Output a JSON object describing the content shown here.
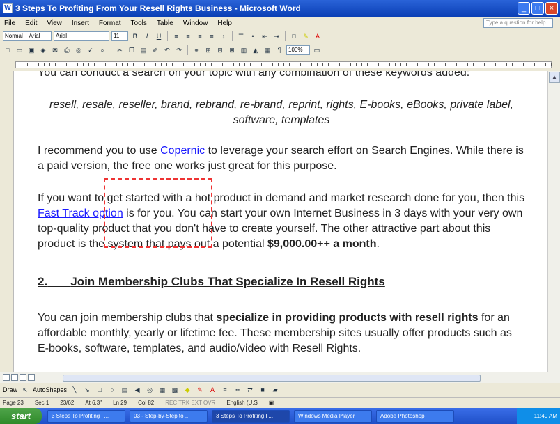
{
  "window": {
    "title": "3 Steps To Profiting From Your Resell Rights Business - Microsoft Word",
    "icon": "word-icon"
  },
  "menu": [
    "File",
    "Edit",
    "View",
    "Insert",
    "Format",
    "Tools",
    "Table",
    "Window",
    "Help"
  ],
  "ask_box": {
    "placeholder": "Type a question for help"
  },
  "toolbar": {
    "style_value": "Normal + Arial",
    "font_value": "Arial",
    "size_value": "11",
    "zoom_value": "100%"
  },
  "document": {
    "line_top": "You can conduct a search on your topic with any combination of these keywords added:",
    "keywords": "resell, resale, reseller, brand, rebrand, re-brand, reprint, rights, E-books, eBooks, private label, software, templates",
    "p1_pre": "I recommend you to use ",
    "p1_link": "Copernic",
    "p1_post": " to leverage your search effort on Search Engines. While there is a paid version, the free one works just great for this purpose.",
    "p2_pre": "If you want to get started with a hot product in demand and market research done for you, then this ",
    "p2_link": "Fast Track option",
    "p2_post": " is for you. You can start your own Internet Business in 3 days with your very own top-quality product that you don't have to create yourself. The other attractive part about this product is the system that pays out a potential ",
    "p2_bold": "$9,000.00++ a month",
    "p2_end": ".",
    "heading_num": "2.",
    "heading_text": "Join Membership Clubs That Specialize In Resell Rights",
    "p3_pre": "You can join membership clubs that ",
    "p3_bold": "specialize in providing products with resell rights",
    "p3_post": " for an affordable monthly, yearly or lifetime fee. These membership sites usually offer products such as E-books, software, templates, and audio/video with Resell Rights."
  },
  "drawbar": {
    "draw_label": "Draw",
    "autoshapes_label": "AutoShapes"
  },
  "status": {
    "page": "Page 23",
    "sec": "Sec 1",
    "pages": "23/62",
    "at": "At 6.3\"",
    "ln": "Ln 29",
    "col": "Col 82",
    "modes": "REC TRK EXT OVR",
    "lang": "English (U.S"
  },
  "taskbar": {
    "start_label": "start",
    "tasks": [
      "3 Steps To Profiting F...",
      "03 - Step-by-Step to ...",
      "3 Steps To Profiting F...",
      "Windows Media Player",
      "Adobe Photoshop"
    ],
    "clock": "11:40 AM"
  }
}
